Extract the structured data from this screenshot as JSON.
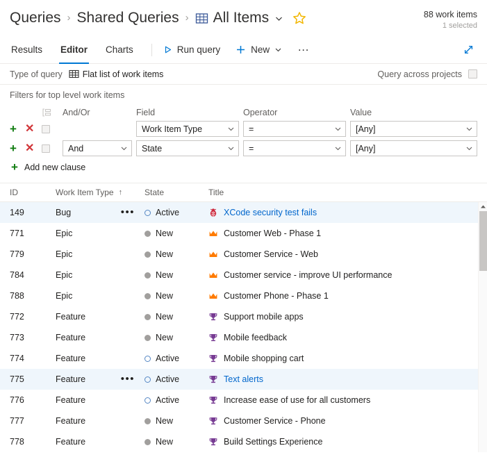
{
  "header": {
    "breadcrumb": [
      {
        "label": "Queries",
        "icon": null
      },
      {
        "label": "Shared Queries",
        "icon": null
      },
      {
        "label": "All Items",
        "icon": "grid-icon"
      }
    ],
    "separator": "›",
    "count_main": "88 work items",
    "count_sub": "1 selected",
    "favorite_icon": "star-icon",
    "dropdown_icon": "chevron-down-icon"
  },
  "commandbar": {
    "tabs": [
      {
        "label": "Results",
        "active": false
      },
      {
        "label": "Editor",
        "active": true
      },
      {
        "label": "Charts",
        "active": false
      }
    ],
    "run_query": "Run query",
    "run_query_icon": "play-icon",
    "new": "New",
    "new_icon": "plus-icon",
    "more_label": "…",
    "expand_icon": "expand-icon"
  },
  "querytype": {
    "label": "Type of query",
    "value": "Flat list of work items",
    "value_icon": "grid-icon",
    "across_projects_label": "Query across projects",
    "across_projects_checked": false
  },
  "filters": {
    "title": "Filters for top level work items",
    "columns": {
      "group": "group-icon",
      "andor": "And/Or",
      "field": "Field",
      "operator": "Operator",
      "value": "Value"
    },
    "rows": [
      {
        "andor": "",
        "field": "Work Item Type",
        "operator": "=",
        "value": "[Any]",
        "checked": false
      },
      {
        "andor": "And",
        "field": "State",
        "operator": "=",
        "value": "[Any]",
        "checked": false
      }
    ],
    "add_clause": "Add new clause",
    "add_icon": "plus-icon",
    "delete_icon": "close-icon"
  },
  "results": {
    "columns": [
      "ID",
      "Work Item Type",
      "State",
      "Title"
    ],
    "sorted_column": "Work Item Type",
    "sort_direction": "↑",
    "rows": [
      {
        "id": "149",
        "type": "Bug",
        "state": "Active",
        "title": "XCode security test fails",
        "icon": "bug-icon",
        "selected": true,
        "menu": true
      },
      {
        "id": "771",
        "type": "Epic",
        "state": "New",
        "title": "Customer Web - Phase 1",
        "icon": "crown-icon",
        "selected": false,
        "menu": false
      },
      {
        "id": "779",
        "type": "Epic",
        "state": "New",
        "title": "Customer Service - Web",
        "icon": "crown-icon",
        "selected": false,
        "menu": false
      },
      {
        "id": "784",
        "type": "Epic",
        "state": "New",
        "title": "Customer service - improve UI performance",
        "icon": "crown-icon",
        "selected": false,
        "menu": false
      },
      {
        "id": "788",
        "type": "Epic",
        "state": "New",
        "title": "Customer Phone - Phase 1",
        "icon": "crown-icon",
        "selected": false,
        "menu": false
      },
      {
        "id": "772",
        "type": "Feature",
        "state": "New",
        "title": "Support mobile apps",
        "icon": "trophy-icon",
        "selected": false,
        "menu": false
      },
      {
        "id": "773",
        "type": "Feature",
        "state": "New",
        "title": "Mobile feedback",
        "icon": "trophy-icon",
        "selected": false,
        "menu": false
      },
      {
        "id": "774",
        "type": "Feature",
        "state": "Active",
        "title": "Mobile shopping cart",
        "icon": "trophy-icon",
        "selected": false,
        "menu": false
      },
      {
        "id": "775",
        "type": "Feature",
        "state": "Active",
        "title": "Text alerts",
        "icon": "trophy-icon",
        "selected": true,
        "menu": true
      },
      {
        "id": "776",
        "type": "Feature",
        "state": "Active",
        "title": "Increase ease of use for all customers",
        "icon": "trophy-icon",
        "selected": false,
        "menu": false
      },
      {
        "id": "777",
        "type": "Feature",
        "state": "New",
        "title": "Customer Service - Phone",
        "icon": "trophy-icon",
        "selected": false,
        "menu": false
      },
      {
        "id": "778",
        "type": "Feature",
        "state": "New",
        "title": "Build Settings Experience",
        "icon": "trophy-icon",
        "selected": false,
        "menu": false
      }
    ],
    "row_menu_label": "•••"
  },
  "colors": {
    "accent": "#0078d4",
    "link": "#0066cc",
    "bug": "#cc293d",
    "epic": "#ff7b00",
    "feature": "#773b93",
    "state_new": "#a19f9d",
    "state_active": "#5587c4",
    "add": "#107c10",
    "delete": "#d13438",
    "star": "#f2b600",
    "selected_row_bg": "#eff6fc"
  }
}
